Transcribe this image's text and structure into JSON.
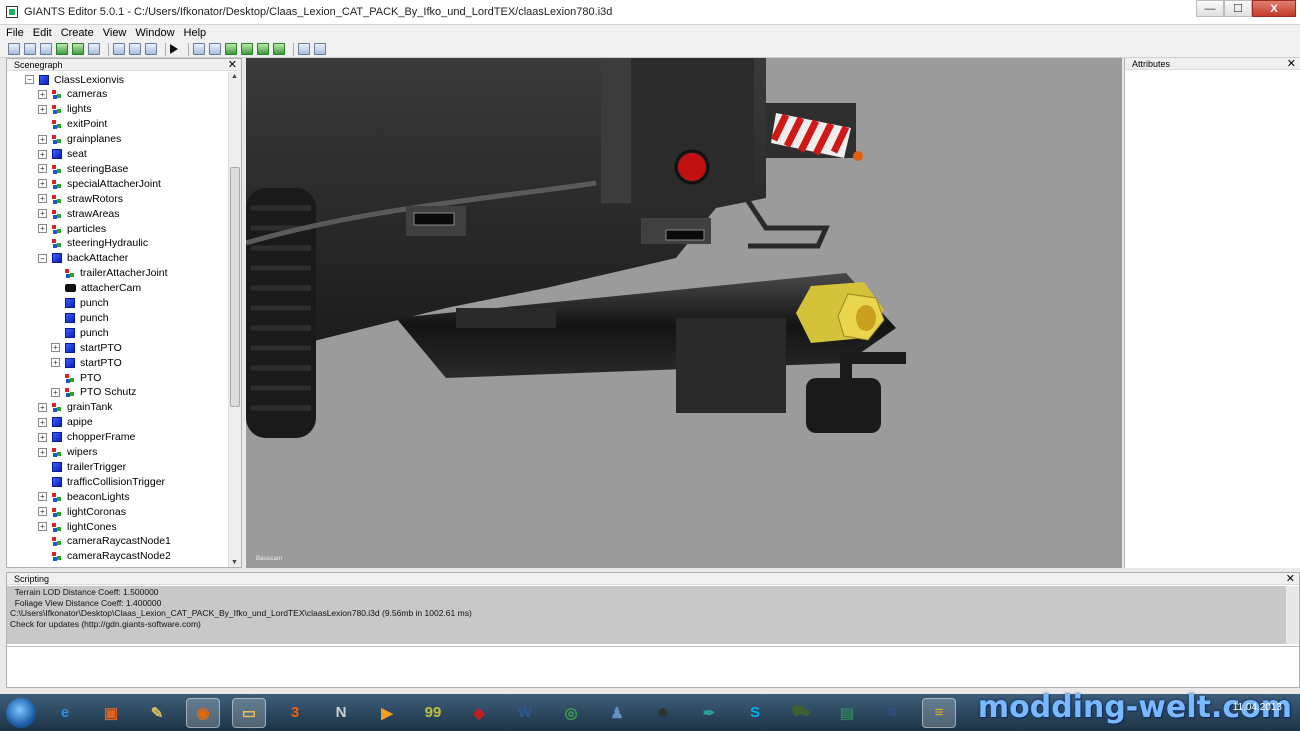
{
  "window": {
    "title": "GIANTS Editor 5.0.1 - C:/Users/Ifkonator/Desktop/Claas_Lexion_CAT_PACK_By_Ifko_und_LordTEX/claasLexion780.i3d",
    "minimize": "—",
    "maximize": "☐",
    "close": "X"
  },
  "menu": [
    "File",
    "Edit",
    "Create",
    "View",
    "Window",
    "Help"
  ],
  "panels": {
    "scenegraph_title": "Scenegraph",
    "attributes_title": "Attributes",
    "scripting_title": "Scripting",
    "close_glyph": "✕"
  },
  "scenegraph": {
    "nodes": [
      {
        "label": "ClassLexionvis",
        "icon": "cube-icon",
        "expand": "−"
      },
      {
        "label": "cameras",
        "icon": "transform-group-icon",
        "expand": "+"
      },
      {
        "label": "lights",
        "icon": "transform-group-icon",
        "expand": "+"
      },
      {
        "label": "exitPoint",
        "icon": "transform-group-icon",
        "expand": ""
      },
      {
        "label": "grainplanes",
        "icon": "transform-group-icon",
        "expand": "+"
      },
      {
        "label": "seat",
        "icon": "cube-icon",
        "expand": "+"
      },
      {
        "label": "steeringBase",
        "icon": "transform-group-icon",
        "expand": "+"
      },
      {
        "label": "specialAttacherJoint",
        "icon": "transform-group-icon",
        "expand": "+"
      },
      {
        "label": "strawRotors",
        "icon": "transform-group-icon",
        "expand": "+"
      },
      {
        "label": "strawAreas",
        "icon": "transform-group-icon",
        "expand": "+"
      },
      {
        "label": "particles",
        "icon": "transform-group-icon",
        "expand": "+"
      },
      {
        "label": "steeringHydraulic",
        "icon": "transform-group-icon",
        "expand": ""
      },
      {
        "label": "backAttacher",
        "icon": "cube-icon",
        "expand": "−"
      },
      {
        "label": "trailerAttacherJoint",
        "icon": "transform-group-icon",
        "expand": ""
      },
      {
        "label": "attacherCam",
        "icon": "camera-icon",
        "expand": ""
      },
      {
        "label": "punch",
        "icon": "cube-icon",
        "expand": ""
      },
      {
        "label": "punch",
        "icon": "cube-icon",
        "expand": ""
      },
      {
        "label": "punch",
        "icon": "cube-icon",
        "expand": ""
      },
      {
        "label": "startPTO",
        "icon": "cube-icon",
        "expand": "+"
      },
      {
        "label": "startPTO",
        "icon": "cube-icon",
        "expand": "+"
      },
      {
        "label": "PTO",
        "icon": "transform-group-icon",
        "expand": ""
      },
      {
        "label": "PTO Schutz",
        "icon": "transform-group-icon",
        "expand": "+"
      },
      {
        "label": "grainTank",
        "icon": "transform-group-icon",
        "expand": "+"
      },
      {
        "label": "apipe",
        "icon": "cube-icon",
        "expand": "+"
      },
      {
        "label": "chopperFrame",
        "icon": "cube-icon",
        "expand": "+"
      },
      {
        "label": "wipers",
        "icon": "transform-group-icon",
        "expand": "+"
      },
      {
        "label": "trailerTrigger",
        "icon": "cube-icon",
        "expand": ""
      },
      {
        "label": "trafficCollisionTrigger",
        "icon": "cube-icon",
        "expand": ""
      },
      {
        "label": "beaconLights",
        "icon": "transform-group-icon",
        "expand": "+"
      },
      {
        "label": "lightCoronas",
        "icon": "transform-group-icon",
        "expand": "+"
      },
      {
        "label": "lightCones",
        "icon": "transform-group-icon",
        "expand": "+"
      },
      {
        "label": "cameraRaycastNode1",
        "icon": "transform-group-icon",
        "expand": ""
      },
      {
        "label": "cameraRaycastNode2",
        "icon": "transform-group-icon",
        "expand": ""
      }
    ]
  },
  "viewport": {
    "camera_label": "Basiscam"
  },
  "scripting": {
    "lines": [
      "  Terrain LOD Distance Coeff: 1.500000",
      "  Foliage View Distance Coeff: 1.400000",
      "C:\\Users\\Ifkonator\\Desktop\\Claas_Lexion_CAT_PACK_By_Ifko_und_LordTEX\\claasLexion780.i3d (9.56mb in 1002.61 ms)",
      "Check for updates (http://gdn.giants-software.com)"
    ]
  },
  "taskbar": {
    "apps": [
      {
        "name": "internet-explorer-icon",
        "glyph": "e",
        "color": "#2f8fe0"
      },
      {
        "name": "package-icon",
        "glyph": "▣",
        "color": "#e06020"
      },
      {
        "name": "paint-icon",
        "glyph": "✎",
        "color": "#d8c060"
      },
      {
        "name": "firefox-icon",
        "glyph": "◉",
        "color": "#e06a10"
      },
      {
        "name": "folder-icon",
        "glyph": "▭",
        "color": "#e8c050"
      },
      {
        "name": "app-3-icon",
        "glyph": "3",
        "color": "#e86010"
      },
      {
        "name": "notepad-icon",
        "glyph": "N",
        "color": "#d0d0d0"
      },
      {
        "name": "media-player-icon",
        "glyph": "▶",
        "color": "#f0a020"
      },
      {
        "name": "game-99-icon",
        "glyph": "99",
        "color": "#c0c040"
      },
      {
        "name": "tractor-game-icon",
        "glyph": "◆",
        "color": "#c02020"
      },
      {
        "name": "word-icon",
        "glyph": "W",
        "color": "#2b5797"
      },
      {
        "name": "chrome-icon",
        "glyph": "◎",
        "color": "#3aa04a"
      },
      {
        "name": "figure-icon",
        "glyph": "♟",
        "color": "#6090c0"
      },
      {
        "name": "character-icon",
        "glyph": "☻",
        "color": "#303030"
      },
      {
        "name": "feather-icon",
        "glyph": "✒",
        "color": "#30a0a0"
      },
      {
        "name": "skype-icon",
        "glyph": "S",
        "color": "#00aff0"
      },
      {
        "name": "tractor-icon",
        "glyph": "⛟",
        "color": "#406030"
      },
      {
        "name": "window-icon",
        "glyph": "▤",
        "color": "#308060"
      },
      {
        "name": "stack-icon",
        "glyph": "≡",
        "color": "#3050a0"
      },
      {
        "name": "giants-editor-icon",
        "glyph": "≡",
        "color": "#e0b020"
      }
    ],
    "date": "11.04.2013",
    "time": "",
    "watermark": "modding-welt.com"
  }
}
